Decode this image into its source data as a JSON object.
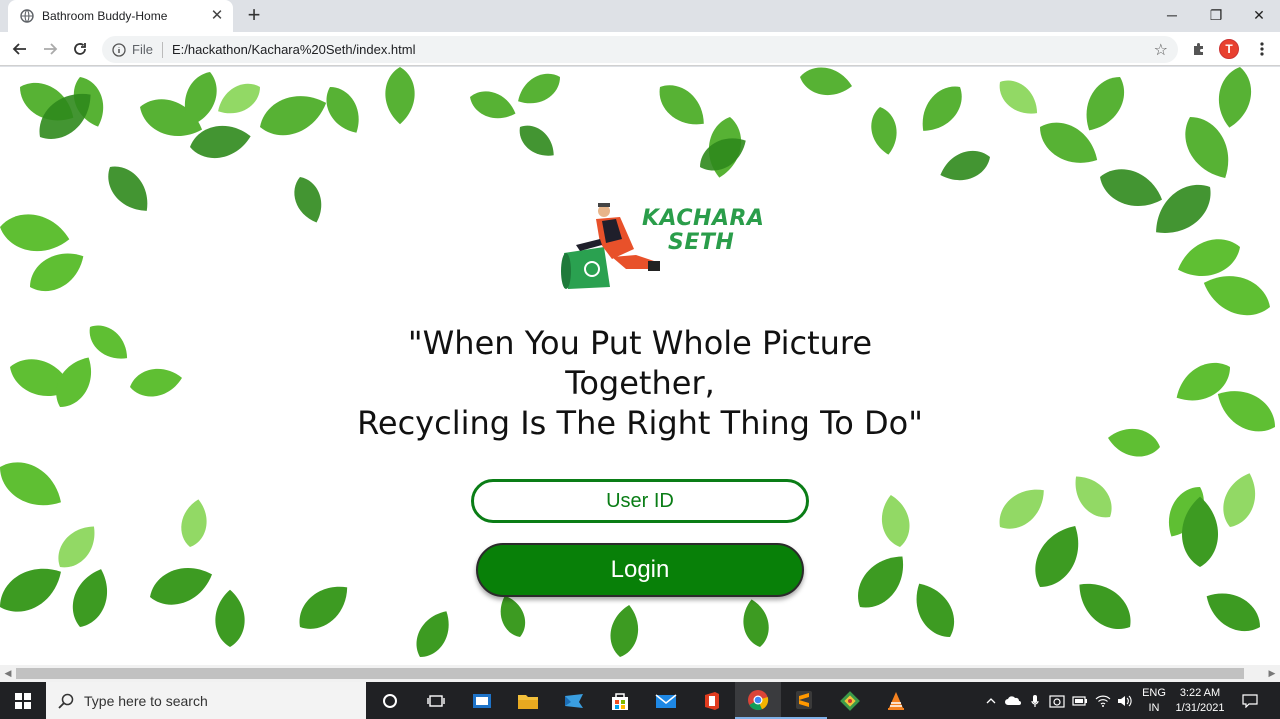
{
  "browser": {
    "tab_title": "Bathroom Buddy-Home",
    "address_prefix": "File",
    "url": "E:/hackathon/Kachara%20Seth/index.html",
    "profile_initial": "T"
  },
  "page": {
    "logo": {
      "line1": "KACHARA",
      "line2": "SETH"
    },
    "quote": {
      "line1": "\"When You Put Whole Picture",
      "line2": "Together,",
      "line3": "Recycling Is The Right Thing To Do\""
    },
    "user_id_placeholder": "User ID",
    "login_label": "Login",
    "colors": {
      "accent_green": "#088008",
      "border_green": "#0a7d16"
    }
  },
  "taskbar": {
    "search_placeholder": "Type here to search",
    "lang_line1": "ENG",
    "lang_line2": "IN",
    "time": "3:22 AM",
    "date": "1/31/2021",
    "icons": [
      "start-icon",
      "cortana-icon",
      "task-view-icon",
      "calculator-icon",
      "file-explorer-icon",
      "ribbon-app-icon",
      "store-icon",
      "mail-icon",
      "office-icon",
      "chrome-icon",
      "sublime-icon",
      "git-icon",
      "vlc-icon"
    ]
  }
}
